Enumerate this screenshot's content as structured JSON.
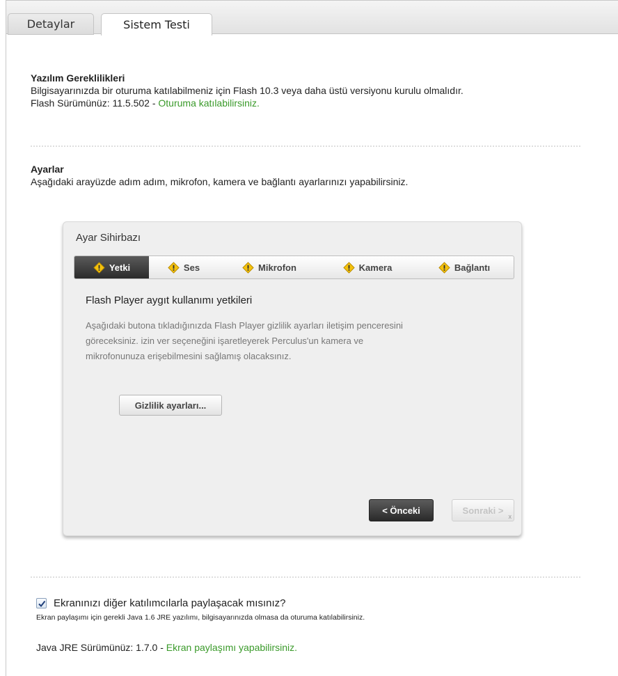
{
  "tabs": {
    "details": "Detaylar",
    "system_test": "Sistem Testi"
  },
  "software": {
    "heading": "Yazılım Gereklilikleri",
    "description": "Bilgisayarınızda bir oturuma katılabilmeniz için Flash 10.3 veya daha üstü versiyonu kurulu olmalıdır.",
    "flash_version_label": "Flash Sürümünüz: 11.5.502 - ",
    "flash_status": "Oturuma katılabilirsiniz."
  },
  "settings": {
    "heading": "Ayarlar",
    "description": "Aşağıdaki arayüzde adım adım, mikrofon, kamera ve bağlantı ayarlarınızı yapabilirsiniz."
  },
  "wizard": {
    "title": "Ayar Sihirbazı",
    "steps": [
      {
        "label": "Yetki"
      },
      {
        "label": "Ses"
      },
      {
        "label": "Mikrofon"
      },
      {
        "label": "Kamera"
      },
      {
        "label": "Bağlantı"
      }
    ],
    "panel_title": "Flash Player aygıt kullanımı yetkileri",
    "panel_description": "Aşağıdaki butona tıkladığınızda Flash Player gizlilik ayarları iletişim penceresini göreceksiniz. izin ver seçeneğini işaretleyerek Perculus'un kamera ve mikrofonunuza erişebilmesini sağlamış olacaksınız.",
    "privacy_button": "Gizlilik ayarları...",
    "prev_button": "< Önceki",
    "next_button": "Sonraki >",
    "next_corner": "x"
  },
  "share": {
    "question": "Ekranınızı diğer katılımcılarla paylaşacak mısınız?",
    "checked": true,
    "note": "Ekran paylaşımı için gerekli Java 1.6 JRE yazılımı, bilgisayarınızda olmasa da oturuma katılabilirsiniz.",
    "java_version_label": "Java JRE Sürümünüz: 1.7.0 - ",
    "java_status": "Ekran paylaşımı yapabilirsiniz."
  },
  "colors": {
    "success_text": "#3a9a2a",
    "warning_icon": "#f4c20d",
    "active_step_bg": "#333333"
  },
  "icons": {
    "step_status": "warning-icon",
    "share_checkbox": "checkmark-icon"
  }
}
